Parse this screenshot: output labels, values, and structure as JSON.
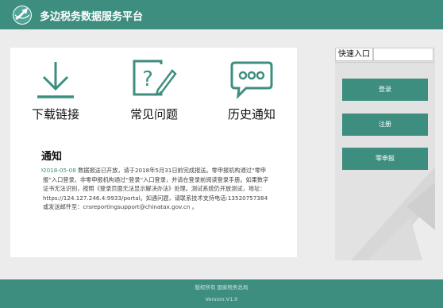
{
  "header": {
    "title": "多边税务数据服务平台",
    "logo_icon": "globe-arrow-logo-icon",
    "background": "#3e8e80"
  },
  "main": {
    "links": [
      {
        "label": "下载链接",
        "icon": "download-icon"
      },
      {
        "label": "常见问题",
        "icon": "faq-question-icon"
      },
      {
        "label": "历史通知",
        "icon": "chat-bubble-icon"
      }
    ],
    "notice": {
      "title": "通知",
      "date": "2018-05-08",
      "text": "数据报送已开放，请于2018年5月31日前完成报送。零申报机构通过“零申报”入口登录，非零申报机构通过“登录”入口登录，并请在登录前阅读登录手册。如果数字证书无法识别，按照《登录页面无法显示解决办法》处理。测试系统仍开放测试，地址：https://124.127.246.4:9933/portal。如遇问题，请联系技术支持电话:13520757384 或发送邮件至：crsreportingsupport@chinatax.gov.cn 。"
    }
  },
  "sidebar": {
    "tab_label": "快速入口",
    "search_value": "",
    "buttons": {
      "login": "登录",
      "register": "注册",
      "zero_report": "零申报"
    }
  },
  "footer": {
    "copyright": "版权所有 国家税务总局",
    "version": "Version:V1.0"
  },
  "colors": {
    "accent": "#3e8e80",
    "page_bg": "#ececec",
    "panel_bg": "#ffffff"
  }
}
